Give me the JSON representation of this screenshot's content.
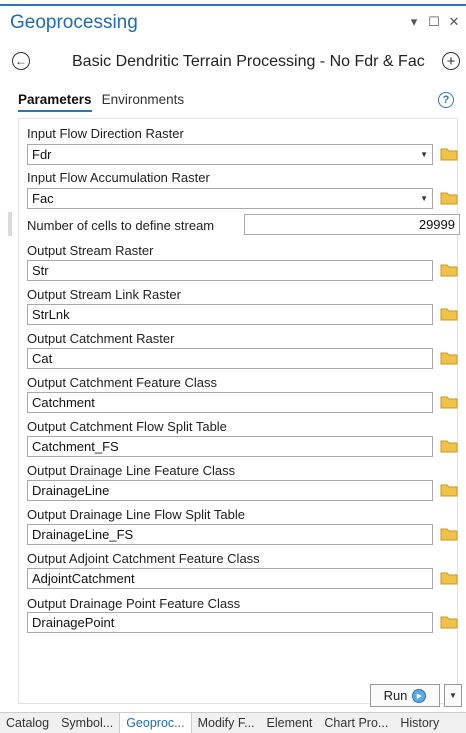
{
  "window": {
    "title": "Geoprocessing"
  },
  "tool": {
    "title": "Basic Dendritic Terrain Processing - No Fdr & Fac"
  },
  "tabs": [
    {
      "label": "Parameters"
    },
    {
      "label": "Environments"
    }
  ],
  "params": {
    "fdr": {
      "label": "Input Flow Direction Raster",
      "value": "Fdr"
    },
    "fac": {
      "label": "Input Flow Accumulation Raster",
      "value": "Fac"
    },
    "cells": {
      "label": "Number of cells to define stream",
      "value": "29999"
    },
    "str": {
      "label": "Output Stream Raster",
      "value": "Str"
    },
    "strlnk": {
      "label": "Output Stream Link Raster",
      "value": "StrLnk"
    },
    "cat": {
      "label": "Output Catchment Raster",
      "value": "Cat"
    },
    "catfc": {
      "label": "Output Catchment Feature Class",
      "value": "Catchment"
    },
    "catfs": {
      "label": "Output Catchment Flow Split Table",
      "value": "Catchment_FS"
    },
    "dl": {
      "label": "Output Drainage Line Feature Class",
      "value": "DrainageLine"
    },
    "dlfs": {
      "label": "Output Drainage Line Flow Split Table",
      "value": "DrainageLine_FS"
    },
    "adj": {
      "label": "Output Adjoint Catchment Feature Class",
      "value": "AdjointCatchment"
    },
    "dp": {
      "label": "Output Drainage Point Feature Class",
      "value": "DrainagePoint"
    }
  },
  "run": {
    "label": "Run"
  },
  "bottom_tabs": [
    {
      "label": "Catalog"
    },
    {
      "label": "Symbol..."
    },
    {
      "label": "Geoproc..."
    },
    {
      "label": "Modify F..."
    },
    {
      "label": "Element"
    },
    {
      "label": "Chart Pro..."
    },
    {
      "label": "History"
    }
  ],
  "colors": {
    "accent": "#1f6cb2",
    "folder": "#f0c24a"
  },
  "icons": {
    "back": "back-arrow-icon",
    "add": "add-icon",
    "help": "help-icon",
    "folder": "folder-icon",
    "run": "run-icon"
  }
}
